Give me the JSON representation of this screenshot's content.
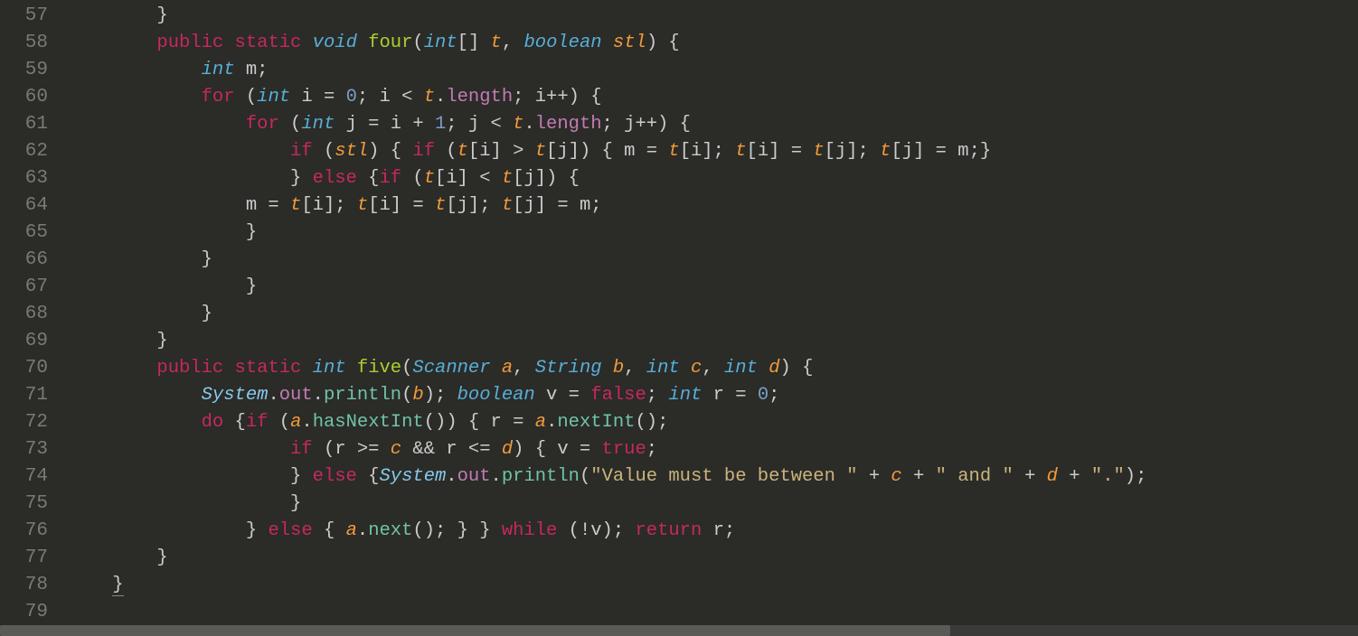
{
  "gutter": {
    "start": 57,
    "end": 79
  },
  "code": {
    "lines": [
      [
        [
          "        ",
          "pl"
        ],
        [
          "}",
          "br"
        ]
      ],
      [
        [
          "        ",
          "pl"
        ],
        [
          "public",
          "k"
        ],
        [
          " ",
          "pl"
        ],
        [
          "static",
          "k"
        ],
        [
          " ",
          "pl"
        ],
        [
          "void",
          "kt"
        ],
        [
          " ",
          "pl"
        ],
        [
          "four",
          "fn"
        ],
        [
          "(",
          "br"
        ],
        [
          "int",
          "kt"
        ],
        [
          "[] ",
          "br"
        ],
        [
          "t",
          "pm"
        ],
        [
          ", ",
          "br"
        ],
        [
          "boolean",
          "kt"
        ],
        [
          " ",
          "pl"
        ],
        [
          "stl",
          "pm"
        ],
        [
          ") {",
          "br"
        ]
      ],
      [
        [
          "            ",
          "pl"
        ],
        [
          "int",
          "kt"
        ],
        [
          " m;",
          "vd"
        ]
      ],
      [
        [
          "            ",
          "pl"
        ],
        [
          "for",
          "k"
        ],
        [
          " (",
          "br"
        ],
        [
          "int",
          "kt"
        ],
        [
          " i = ",
          "vd"
        ],
        [
          "0",
          "nm"
        ],
        [
          "; i < ",
          "vd"
        ],
        [
          "t",
          "pm"
        ],
        [
          ".",
          "vd"
        ],
        [
          "length",
          "fld"
        ],
        [
          "; i++) {",
          "vd"
        ]
      ],
      [
        [
          "                ",
          "pl"
        ],
        [
          "for",
          "k"
        ],
        [
          " (",
          "br"
        ],
        [
          "int",
          "kt"
        ],
        [
          " j = i + ",
          "vd"
        ],
        [
          "1",
          "nm"
        ],
        [
          "; j < ",
          "vd"
        ],
        [
          "t",
          "pm"
        ],
        [
          ".",
          "vd"
        ],
        [
          "length",
          "fld"
        ],
        [
          "; j++) {",
          "vd"
        ]
      ],
      [
        [
          "                    ",
          "pl"
        ],
        [
          "if",
          "k"
        ],
        [
          " (",
          "br"
        ],
        [
          "stl",
          "pm"
        ],
        [
          ") { ",
          "br"
        ],
        [
          "if",
          "k"
        ],
        [
          " (",
          "br"
        ],
        [
          "t",
          "pm"
        ],
        [
          "[i] > ",
          "vd"
        ],
        [
          "t",
          "pm"
        ],
        [
          "[j]) { m = ",
          "vd"
        ],
        [
          "t",
          "pm"
        ],
        [
          "[i]; ",
          "vd"
        ],
        [
          "t",
          "pm"
        ],
        [
          "[i] = ",
          "vd"
        ],
        [
          "t",
          "pm"
        ],
        [
          "[j]; ",
          "vd"
        ],
        [
          "t",
          "pm"
        ],
        [
          "[j] = m;}",
          "vd"
        ]
      ],
      [
        [
          "                    } ",
          "br"
        ],
        [
          "else",
          "k"
        ],
        [
          " {",
          "br"
        ],
        [
          "if",
          "k"
        ],
        [
          " (",
          "br"
        ],
        [
          "t",
          "pm"
        ],
        [
          "[i] < ",
          "vd"
        ],
        [
          "t",
          "pm"
        ],
        [
          "[j]) {",
          "vd"
        ]
      ],
      [
        [
          "                m = ",
          "vd"
        ],
        [
          "t",
          "pm"
        ],
        [
          "[i]; ",
          "vd"
        ],
        [
          "t",
          "pm"
        ],
        [
          "[i] = ",
          "vd"
        ],
        [
          "t",
          "pm"
        ],
        [
          "[j]; ",
          "vd"
        ],
        [
          "t",
          "pm"
        ],
        [
          "[j] = m;",
          "vd"
        ]
      ],
      [
        [
          "                }",
          "br"
        ]
      ],
      [
        [
          "            }",
          "br"
        ]
      ],
      [
        [
          "                }",
          "br"
        ]
      ],
      [
        [
          "            }",
          "br"
        ]
      ],
      [
        [
          "        }",
          "br"
        ]
      ],
      [
        [
          "        ",
          "pl"
        ],
        [
          "public",
          "k"
        ],
        [
          " ",
          "pl"
        ],
        [
          "static",
          "k"
        ],
        [
          " ",
          "pl"
        ],
        [
          "int",
          "kt"
        ],
        [
          " ",
          "pl"
        ],
        [
          "five",
          "fn"
        ],
        [
          "(",
          "br"
        ],
        [
          "Scanner",
          "kt"
        ],
        [
          " ",
          "pl"
        ],
        [
          "a",
          "pm"
        ],
        [
          ", ",
          "br"
        ],
        [
          "String",
          "kt"
        ],
        [
          " ",
          "pl"
        ],
        [
          "b",
          "pm"
        ],
        [
          ", ",
          "br"
        ],
        [
          "int",
          "kt"
        ],
        [
          " ",
          "pl"
        ],
        [
          "c",
          "pm"
        ],
        [
          ", ",
          "br"
        ],
        [
          "int",
          "kt"
        ],
        [
          " ",
          "pl"
        ],
        [
          "d",
          "pm"
        ],
        [
          ") {",
          "br"
        ]
      ],
      [
        [
          "            ",
          "pl"
        ],
        [
          "System",
          "tv"
        ],
        [
          ".",
          "vd"
        ],
        [
          "out",
          "fld"
        ],
        [
          ".",
          "vd"
        ],
        [
          "println",
          "mn"
        ],
        [
          "(",
          "br"
        ],
        [
          "b",
          "pm"
        ],
        [
          "); ",
          "br"
        ],
        [
          "boolean",
          "kt"
        ],
        [
          " v = ",
          "vd"
        ],
        [
          "false",
          "cf"
        ],
        [
          "; ",
          "vd"
        ],
        [
          "int",
          "kt"
        ],
        [
          " r = ",
          "vd"
        ],
        [
          "0",
          "nm"
        ],
        [
          ";",
          "vd"
        ]
      ],
      [
        [
          "            ",
          "pl"
        ],
        [
          "do",
          "k"
        ],
        [
          " {",
          "br"
        ],
        [
          "if",
          "k"
        ],
        [
          " (",
          "br"
        ],
        [
          "a",
          "pm"
        ],
        [
          ".",
          "vd"
        ],
        [
          "hasNextInt",
          "mn"
        ],
        [
          "()) { r = ",
          "vd"
        ],
        [
          "a",
          "pm"
        ],
        [
          ".",
          "vd"
        ],
        [
          "nextInt",
          "mn"
        ],
        [
          "();",
          "vd"
        ]
      ],
      [
        [
          "                    ",
          "pl"
        ],
        [
          "if",
          "k"
        ],
        [
          " (r >= ",
          "vd"
        ],
        [
          "c",
          "pm"
        ],
        [
          " && r <= ",
          "vd"
        ],
        [
          "d",
          "pm"
        ],
        [
          ") { v = ",
          "vd"
        ],
        [
          "true",
          "cf"
        ],
        [
          ";",
          "vd"
        ]
      ],
      [
        [
          "                    } ",
          "br"
        ],
        [
          "else",
          "k"
        ],
        [
          " {",
          "br"
        ],
        [
          "System",
          "tv"
        ],
        [
          ".",
          "vd"
        ],
        [
          "out",
          "fld"
        ],
        [
          ".",
          "vd"
        ],
        [
          "println",
          "mn"
        ],
        [
          "(",
          "br"
        ],
        [
          "\"Value must be between \"",
          "st"
        ],
        [
          " + ",
          "vd"
        ],
        [
          "c",
          "pm"
        ],
        [
          " + ",
          "vd"
        ],
        [
          "\" and \"",
          "st"
        ],
        [
          " + ",
          "vd"
        ],
        [
          "d",
          "pm"
        ],
        [
          " + ",
          "vd"
        ],
        [
          "\".\"",
          "st"
        ],
        [
          ");",
          "vd"
        ]
      ],
      [
        [
          "                    }",
          "br"
        ]
      ],
      [
        [
          "                } ",
          "br"
        ],
        [
          "else",
          "k"
        ],
        [
          " { ",
          "br"
        ],
        [
          "a",
          "pm"
        ],
        [
          ".",
          "vd"
        ],
        [
          "next",
          "mn"
        ],
        [
          "(); } } ",
          "vd"
        ],
        [
          "while",
          "k"
        ],
        [
          " (!v); ",
          "vd"
        ],
        [
          "return",
          "k"
        ],
        [
          " r;",
          "vd"
        ]
      ],
      [
        [
          "        }",
          "br"
        ]
      ],
      [
        [
          "    ",
          "pl"
        ],
        [
          "}",
          "br",
          "underline"
        ]
      ],
      [
        [
          "",
          "pl"
        ]
      ]
    ]
  }
}
